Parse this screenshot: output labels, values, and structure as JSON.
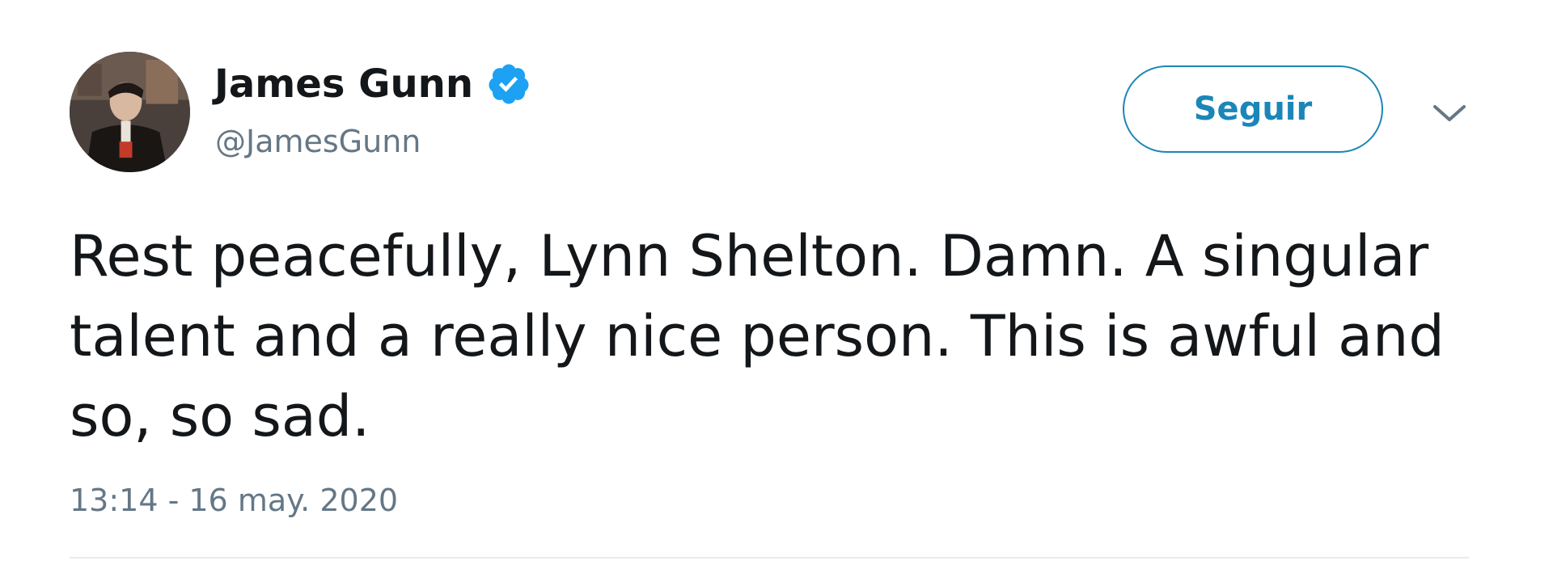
{
  "tweet": {
    "author": {
      "display_name": "James Gunn",
      "handle": "@JamesGunn",
      "verified": true
    },
    "follow_label": "Seguir",
    "text": "Rest peacefully, Lynn Shelton. Damn. A singular talent and a really nice person. This is awful and so, so sad.",
    "timestamp": "13:14 - 16 may. 2020"
  },
  "icons": {
    "verified": "verified-badge-icon",
    "more": "chevron-down-icon"
  },
  "colors": {
    "text_primary": "#14171a",
    "text_secondary": "#657786",
    "accent": "#1b86b8",
    "verified": "#1da1f2",
    "divider": "#e6ecf0"
  }
}
